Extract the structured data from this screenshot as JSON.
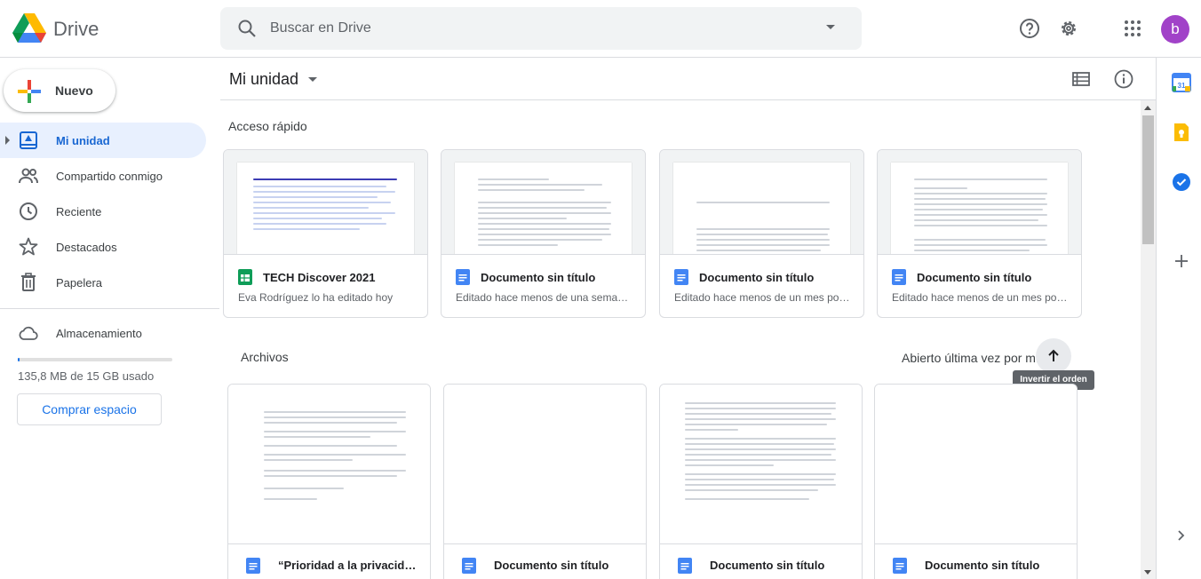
{
  "header": {
    "app_title": "Drive",
    "search_placeholder": "Buscar en Drive",
    "avatar_letter": "b",
    "avatar_color": "#a142c8"
  },
  "sidebar": {
    "new_label": "Nuevo",
    "items": [
      {
        "label": "Mi unidad",
        "icon": "my-drive-icon",
        "active": true
      },
      {
        "label": "Compartido conmigo",
        "icon": "shared-people-icon"
      },
      {
        "label": "Reciente",
        "icon": "clock-icon"
      },
      {
        "label": "Destacados",
        "icon": "star-icon"
      },
      {
        "label": "Papelera",
        "icon": "trash-icon"
      }
    ],
    "storage_label": "Almacenamiento",
    "storage_text": "135,8 MB de 15 GB usado",
    "storage_fraction": 0.009,
    "buy_label": "Comprar espacio"
  },
  "main": {
    "title": "Mi unidad",
    "quick_access_label": "Acceso rápido",
    "quick_access": [
      {
        "name": "TECH Discover 2021",
        "sub": "Eva Rodríguez lo ha editado hoy",
        "type": "sheets"
      },
      {
        "name": "Documento sin título",
        "sub": "Editado hace menos de una seman…",
        "type": "docs"
      },
      {
        "name": "Documento sin título",
        "sub": "Editado hace menos de un mes por…",
        "type": "docs"
      },
      {
        "name": "Documento sin título",
        "sub": "Editado hace menos de un mes por…",
        "type": "docs"
      }
    ],
    "files_label": "Archivos",
    "sort_label": "Abierto última vez por mí",
    "sort_tooltip": "Invertir el orden",
    "files": [
      {
        "name": "“Prioridad a la privacidad …",
        "type": "docs"
      },
      {
        "name": "Documento sin título",
        "type": "docs"
      },
      {
        "name": "Documento sin título",
        "type": "docs"
      },
      {
        "name": "Documento sin título",
        "type": "docs"
      }
    ]
  },
  "colors": {
    "accent": "#1a73e8",
    "active_bg": "#e8f0fe",
    "docs_blue": "#4285f4",
    "sheets_green": "#0f9d58"
  }
}
